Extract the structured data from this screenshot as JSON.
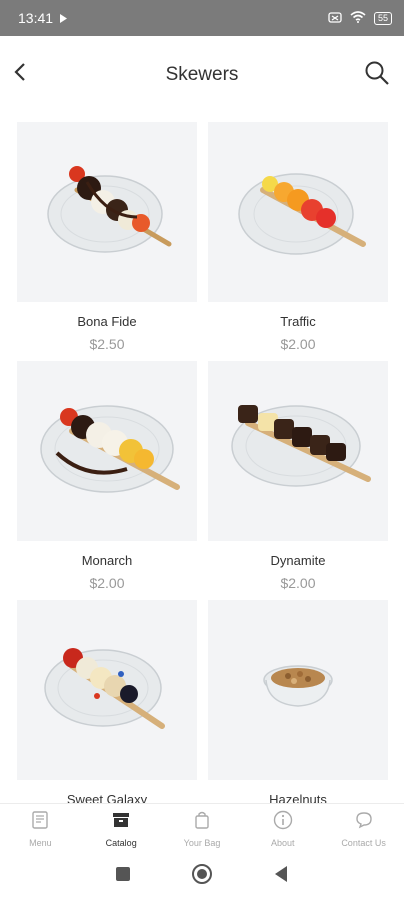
{
  "status": {
    "time": "13:41",
    "battery": "55"
  },
  "header": {
    "title": "Skewers"
  },
  "products": [
    {
      "name": "Bona Fide",
      "price": "$2.50"
    },
    {
      "name": "Traffic",
      "price": "$2.00"
    },
    {
      "name": "Monarch",
      "price": "$2.00"
    },
    {
      "name": "Dynamite",
      "price": "$2.00"
    },
    {
      "name": "Sweet Galaxy",
      "price": ""
    },
    {
      "name": "Hazelnuts",
      "price": ""
    }
  ],
  "nav": [
    {
      "label": "Menu",
      "icon": "menu-book-icon",
      "active": false
    },
    {
      "label": "Catalog",
      "icon": "catalog-icon",
      "active": true
    },
    {
      "label": "Your Bag",
      "icon": "bag-icon",
      "active": false
    },
    {
      "label": "About",
      "icon": "info-icon",
      "active": false
    },
    {
      "label": "Contact Us",
      "icon": "chat-icon",
      "active": false
    }
  ],
  "colors": {
    "accent": "#333333",
    "inactive": "#aaaaaa",
    "card_bg": "#f3f4f6",
    "price": "#999999"
  }
}
